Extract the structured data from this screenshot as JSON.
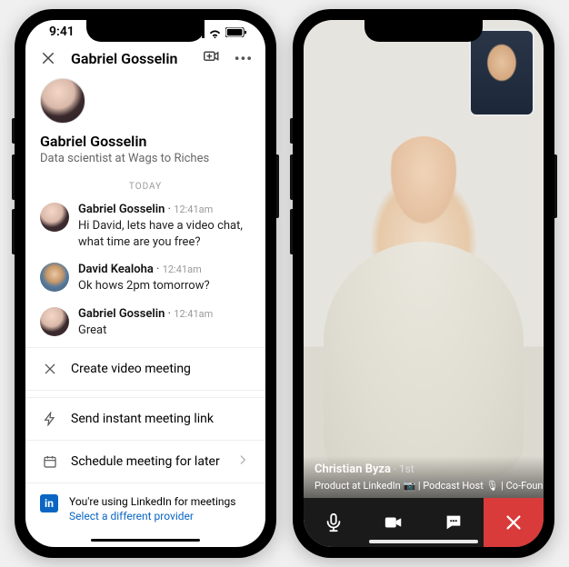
{
  "status": {
    "time": "9:41"
  },
  "nav": {
    "title": "Gabriel Gosselin"
  },
  "profile": {
    "name": "Gabriel Gosselin",
    "subtitle": "Data scientist at Wags to Riches"
  },
  "divider": "TODAY",
  "messages": [
    {
      "author": "Gabriel Gosselin",
      "time": "12:41am",
      "text": "Hi David, lets have a video chat, what time are you free?"
    },
    {
      "author": "David Kealoha",
      "time": "12:41am",
      "text": "Ok hows 2pm tomorrow?"
    },
    {
      "author": "Gabriel Gosselin",
      "time": "12:41am",
      "text": "Great"
    }
  ],
  "options": {
    "create": "Create video meeting",
    "instant": "Send instant meeting link",
    "schedule": "Schedule meeting for later"
  },
  "provider": {
    "badge": "in",
    "text": "You're using LinkedIn for meetings",
    "link": "Select a different provider"
  },
  "call": {
    "participant_name": "Christian Byza",
    "degree": "· 1st",
    "subtitle": "Product at LinkedIn 📷 | Podcast Host 🎙 | Co-Founder of OM…"
  }
}
